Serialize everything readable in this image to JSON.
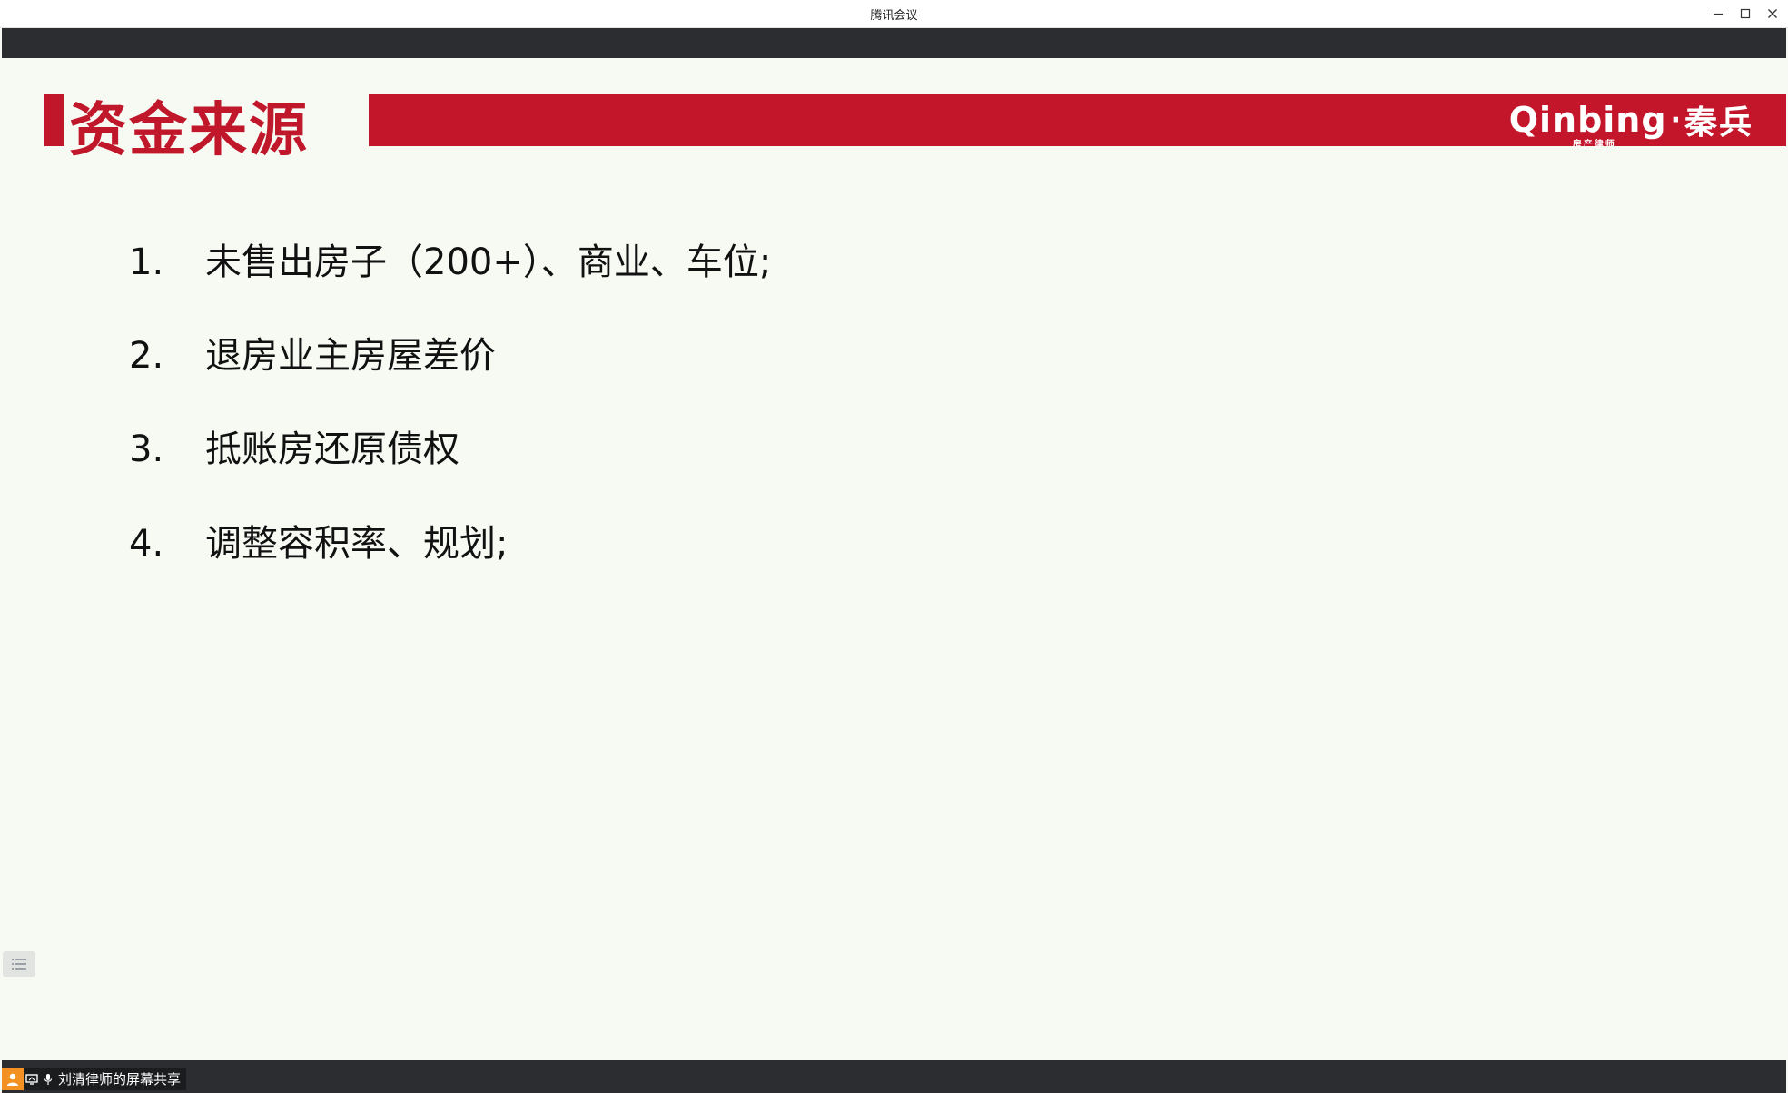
{
  "window": {
    "title": "腾讯会议",
    "minimize_icon": "minimize-icon",
    "maximize_icon": "maximize-icon",
    "close_icon": "close-icon"
  },
  "slide": {
    "title": "资金来源",
    "accent_color": "#c0172b",
    "banner_color": "#c4162b",
    "logo": {
      "latin": "Qinbing",
      "subtitle": "房产律师",
      "separator": "·",
      "chinese": "秦兵"
    },
    "items": [
      {
        "num": "1.",
        "text": "未售出房子（200+）、商业、车位;"
      },
      {
        "num": "2.",
        "text": "退房业主房屋差价"
      },
      {
        "num": "3.",
        "text": "抵账房还原债权"
      },
      {
        "num": "4.",
        "text": "调整容积率、规划;"
      }
    ]
  },
  "notes_toggle_icon": "list-icon",
  "bottom": {
    "share_label": "刘清律师的屏幕共享",
    "avatar_icon": "user-icon",
    "screen_icon": "screen-share-icon",
    "mic_icon": "microphone-icon"
  }
}
